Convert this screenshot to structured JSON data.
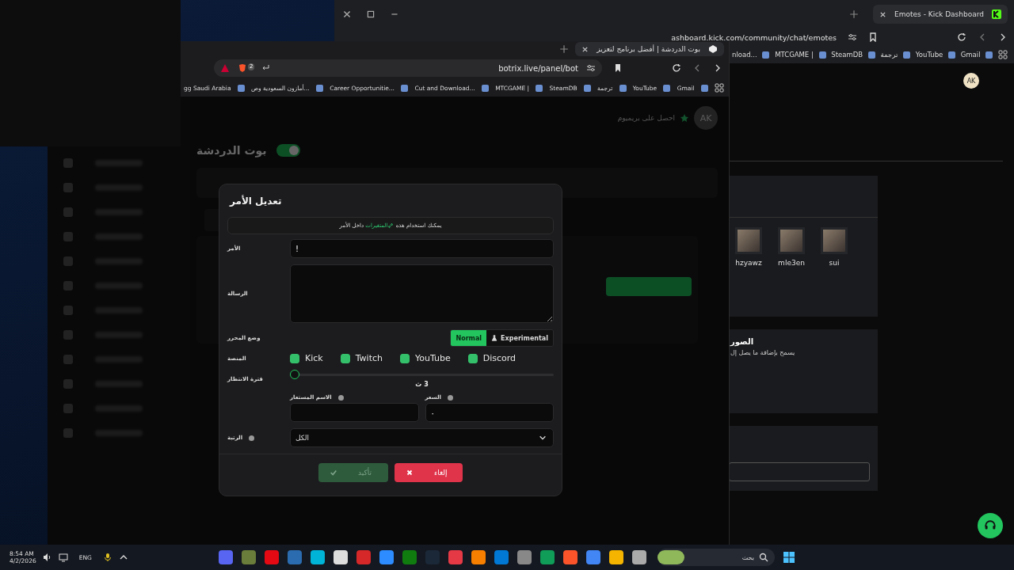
{
  "back_window": {
    "tab": {
      "title": "Emotes - Kick Dashboard"
    },
    "address": "ashboard.kick.com/community/chat/emotes",
    "bookmarks": [
      {
        "label": "Gmail"
      },
      {
        "label": "YouTube"
      },
      {
        "label": "ترجمة"
      },
      {
        "label": "SteamDB"
      },
      {
        "label": "MTCGAME |"
      },
      {
        "label": "nload..."
      }
    ],
    "avatar": "AK",
    "emotes": [
      {
        "name": "sui"
      },
      {
        "name": "mle3en"
      },
      {
        "name": "hzyawz"
      }
    ],
    "images_section": {
      "title": "الصور",
      "description": "يسمح بإضافة ما يصل إل"
    }
  },
  "front_window": {
    "tab": {
      "title": "بوت الدردشة | أفضل برنامج لتعزيز"
    },
    "shields_count": "2",
    "address": "botrix.live/panel/bot",
    "bookmarks": [
      {
        "label": "Gmail"
      },
      {
        "label": "YouTube"
      },
      {
        "label": "ترجمة"
      },
      {
        "label": "SteamDB"
      },
      {
        "label": "MTCGAME |"
      },
      {
        "label": "Cut and Download..."
      },
      {
        "label": "Career Opportunitie..."
      },
      {
        "label": "أمازون السعودية وص..."
      },
      {
        "label": "gg Saudi Arabia"
      }
    ],
    "header": {
      "premium": "احصل على بريميوم",
      "avatar": "AK"
    },
    "page_title": "بوت الدردشة",
    "bot_enabled": true
  },
  "modal": {
    "title": "تعديل الأمر",
    "info": {
      "before": "يمكنك استخدام هذه",
      "link": "المتغيرات",
      "after": "داخل الأمر"
    },
    "command": {
      "label": "الأمر",
      "value": "!"
    },
    "message": {
      "label": "الرسالة"
    },
    "editor_mode": {
      "label": "وضع المحرر",
      "options": [
        {
          "label": "Experimental",
          "selected": false
        },
        {
          "label": "Normal",
          "selected": true
        }
      ]
    },
    "platform": {
      "label": "المنصة",
      "options": [
        {
          "label": "Discord",
          "checked": true
        },
        {
          "label": "YouTube",
          "checked": true
        },
        {
          "label": "Twitch",
          "checked": true
        },
        {
          "label": "Kick",
          "checked": true
        }
      ]
    },
    "cooldown": {
      "label": "فترة الانتظار",
      "level": 0,
      "reading": "3 ث"
    },
    "alias": {
      "label": "الاسم المستعار"
    },
    "price": {
      "label": "السعر",
      "value": "٠"
    },
    "rank": {
      "label": "الرتبة",
      "value": "الكل"
    },
    "buttons": {
      "confirm": {
        "label": "تأكيد",
        "disabled": true
      },
      "cancel": {
        "label": "إلغاء"
      }
    }
  },
  "taskbar": {
    "time": "8:54 AM",
    "date": "4/2/2026",
    "language": "ENG",
    "search": "بحث"
  }
}
